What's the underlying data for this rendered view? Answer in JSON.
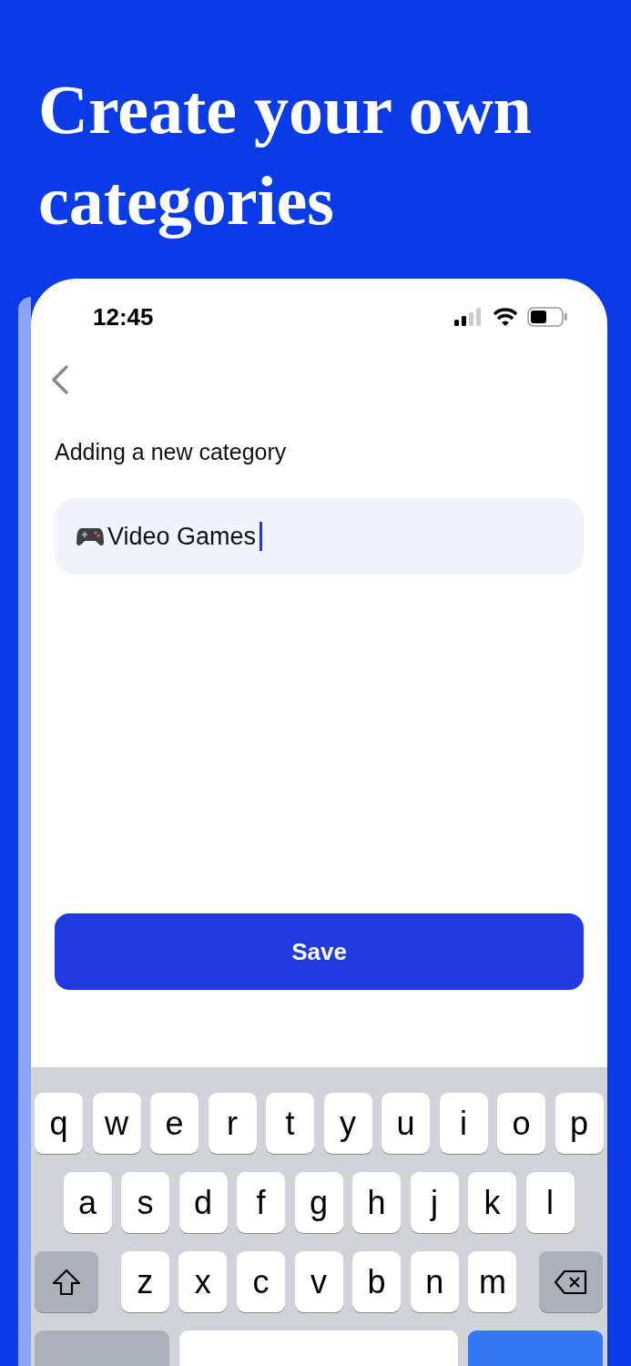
{
  "headline": "Create your own categories",
  "status_bar": {
    "time": "12:45"
  },
  "screen": {
    "title": "Adding a new category",
    "field": {
      "value": "Video Games",
      "focused": true
    },
    "save_button": "Save"
  },
  "keyboard": {
    "rows": [
      [
        {
          "kind": "letter",
          "label": "q"
        },
        {
          "kind": "letter",
          "label": "w"
        },
        {
          "kind": "letter",
          "label": "e"
        },
        {
          "kind": "letter",
          "label": "r"
        },
        {
          "kind": "letter",
          "label": "t"
        },
        {
          "kind": "letter",
          "label": "y"
        },
        {
          "kind": "letter",
          "label": "u"
        },
        {
          "kind": "letter",
          "label": "i"
        },
        {
          "kind": "letter",
          "label": "o"
        },
        {
          "kind": "letter",
          "label": "p"
        }
      ],
      [
        {
          "kind": "letter",
          "label": "a"
        },
        {
          "kind": "letter",
          "label": "s"
        },
        {
          "kind": "letter",
          "label": "d"
        },
        {
          "kind": "letter",
          "label": "f"
        },
        {
          "kind": "letter",
          "label": "g"
        },
        {
          "kind": "letter",
          "label": "h"
        },
        {
          "kind": "letter",
          "label": "j"
        },
        {
          "kind": "letter",
          "label": "k"
        },
        {
          "kind": "letter",
          "label": "l"
        }
      ],
      [
        {
          "kind": "shift"
        },
        {
          "kind": "letter",
          "label": "z"
        },
        {
          "kind": "letter",
          "label": "x"
        },
        {
          "kind": "letter",
          "label": "c"
        },
        {
          "kind": "letter",
          "label": "v"
        },
        {
          "kind": "letter",
          "label": "b"
        },
        {
          "kind": "letter",
          "label": "n"
        },
        {
          "kind": "letter",
          "label": "m"
        },
        {
          "kind": "delete"
        }
      ],
      [
        {
          "kind": "mode"
        },
        {
          "kind": "space"
        },
        {
          "kind": "return"
        }
      ]
    ]
  }
}
